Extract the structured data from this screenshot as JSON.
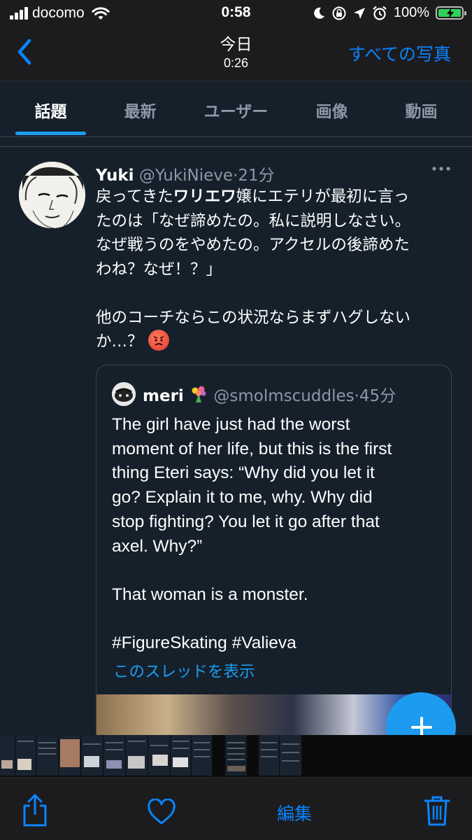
{
  "status_bar": {
    "carrier": "docomo",
    "time": "0:58",
    "battery_percent": "100%",
    "battery_level": 1.0,
    "charging": true
  },
  "nav": {
    "title": "今日",
    "subtitle": "0:26",
    "back_icon": "chevron-left-icon",
    "all_photos_label": "すべての写真"
  },
  "colors": {
    "ios_blue": "#0a84ff",
    "twitter_blue": "#1d9bf0",
    "twitter_bg": "#15202b",
    "muted_text": "#8b98a5",
    "battery_green": "#30d158"
  },
  "twitter": {
    "tabs": [
      {
        "label": "話題",
        "active": true
      },
      {
        "label": "最新",
        "active": false
      },
      {
        "label": "ユーザー",
        "active": false
      },
      {
        "label": "画像",
        "active": false
      },
      {
        "label": "動画",
        "active": false
      }
    ],
    "tweet": {
      "name": "Yuki",
      "handle": "@YukiNieve",
      "time": "21分",
      "lines": [
        {
          "pre": "戻ってきた",
          "bold": "ワリエワ",
          "post": "嬢にエテリが最初に言っ"
        },
        "たのは「なぜ諦めたの。私に説明しなさい。",
        "なぜ戦うのをやめたの。アクセルの後諦めた",
        "わね？なぜ！？」",
        "他のコーチならこの状況ならまずハグしない",
        "か…？"
      ],
      "emoji": "angry-face-emoji"
    },
    "quote": {
      "name": "meri",
      "emoji": "bouquet-emoji",
      "handle": "@smolmscuddles",
      "time": "45分",
      "lines": [
        "The girl have just had the worst",
        "moment of her life, but this is the first",
        "thing Eteri says: “Why did you let it",
        "go? Explain it to me, why. Why did",
        "stop fighting? You let it go after that",
        "axel. Why?”",
        "That woman is a monster.",
        "#FigureSkating #Valieva"
      ],
      "show_thread": "このスレッドを表示"
    },
    "fab_icon": "plus-icon"
  },
  "toolbar": {
    "share_icon": "share-icon",
    "favorite_icon": "heart-icon",
    "edit_label": "編集",
    "delete_icon": "trash-icon"
  }
}
